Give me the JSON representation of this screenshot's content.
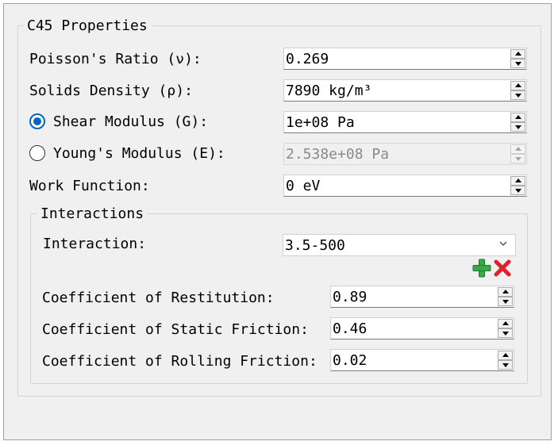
{
  "group": {
    "title": "C45 Properties"
  },
  "fields": {
    "poisson": {
      "label": "Poisson's Ratio (ν):",
      "value": "0.269"
    },
    "density": {
      "label": "Solids Density (ρ):",
      "value": "7890 kg/m³"
    },
    "shear": {
      "label": "Shear Modulus (G):",
      "value": "1e+08 Pa",
      "selected": true
    },
    "young": {
      "label": "Young's Modulus (E):",
      "value": "2.538e+08 Pa",
      "selected": false,
      "enabled": false
    },
    "work": {
      "label": "Work Function:",
      "value": "0 eV"
    }
  },
  "interactions": {
    "title": "Interactions",
    "interaction_label": "Interaction:",
    "interaction_value": "3.5-500",
    "icons": {
      "add": "add-icon",
      "delete": "delete-icon"
    },
    "restitution": {
      "label": "Coefficient of Restitution:",
      "value": "0.89"
    },
    "static_friction": {
      "label": "Coefficient of Static Friction:",
      "value": "0.46"
    },
    "rolling_friction": {
      "label": "Coefficient of Rolling Friction:",
      "value": "0.02"
    }
  },
  "colors": {
    "accent": "#0067c0",
    "add": "#3aa845",
    "delete": "#e0202a"
  }
}
